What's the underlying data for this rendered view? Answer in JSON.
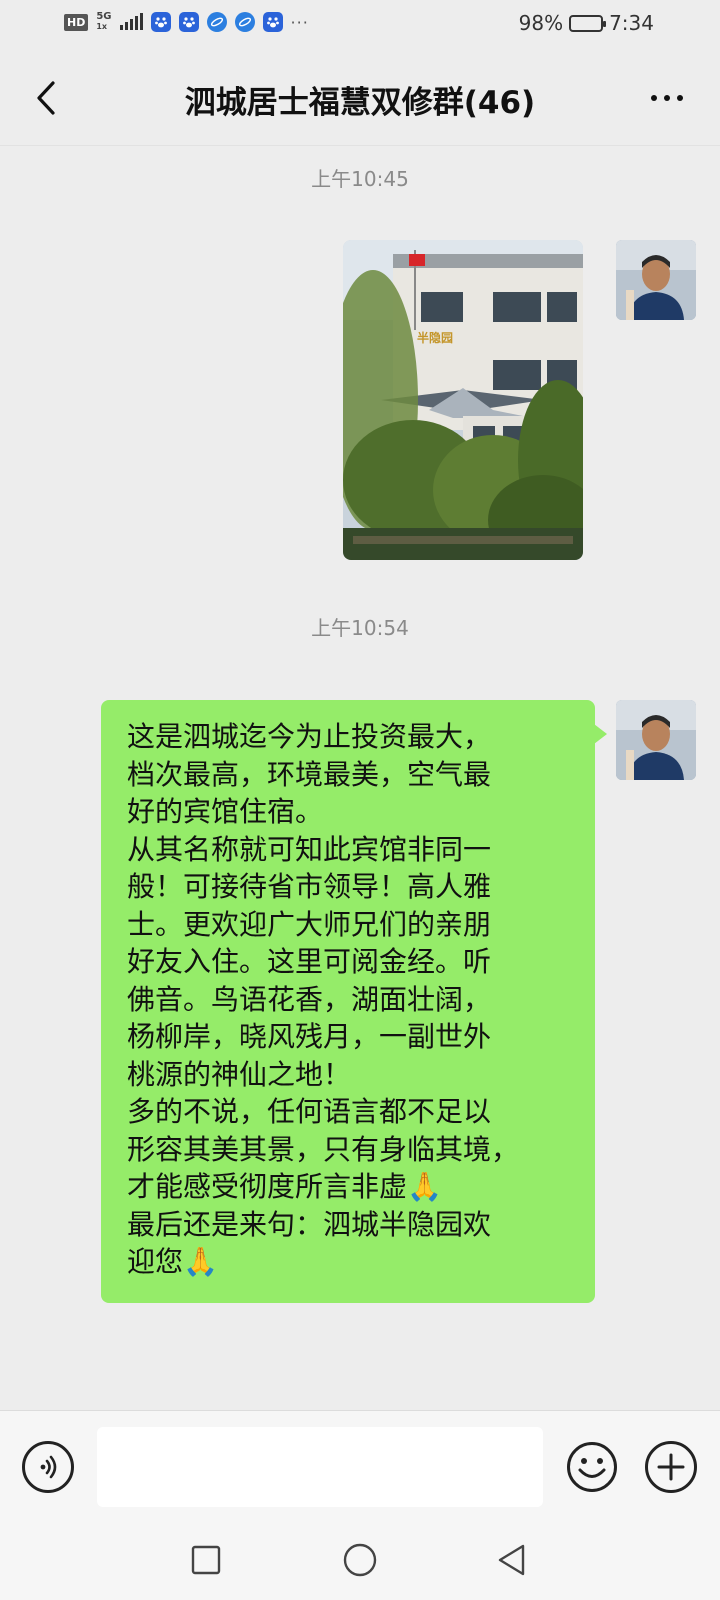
{
  "status_bar": {
    "hd": "HD",
    "network": "5G",
    "network_sub": "1x",
    "more": "···",
    "battery": "98%",
    "battery_level": 0.98,
    "time": "7:34"
  },
  "header": {
    "title": "泗城居士福慧双修群(46)",
    "back_icon": "chevron-left-icon",
    "more_icon": "more-dots-icon"
  },
  "chat": {
    "messages": [
      {
        "timestamp": "上午10:45",
        "type": "image",
        "image_sign": "半隐园"
      },
      {
        "timestamp": "上午10:54",
        "type": "text",
        "lines": [
          "这是泗城迄今为止投资最大，",
          "档次最高，环境最美，空气最",
          "好的宾馆住宿。",
          "从其名称就可知此宾馆非同一",
          "般！可接待省市领导！高人雅",
          "士。更欢迎广大师兄们的亲朋",
          "好友入住。这里可阅金经。听",
          "佛音。鸟语花香，湖面壮阔，",
          "杨柳岸，晓风残月，一副世外",
          "桃源的神仙之地！",
          "多的不说，任何语言都不足以",
          "形容其美其景，只有身临其境，",
          "才能感受彻度所言非虚🙏",
          "最后还是来句：泗城半隐园欢",
          "迎您🙏"
        ]
      }
    ]
  },
  "input_bar": {
    "voice_icon": "voice-icon",
    "input_value": "",
    "emoji_icon": "emoji-icon",
    "plus_icon": "plus-icon"
  },
  "nav_bar": {
    "recent_icon": "square-icon",
    "home_icon": "circle-icon",
    "back_icon": "triangle-back-icon"
  }
}
